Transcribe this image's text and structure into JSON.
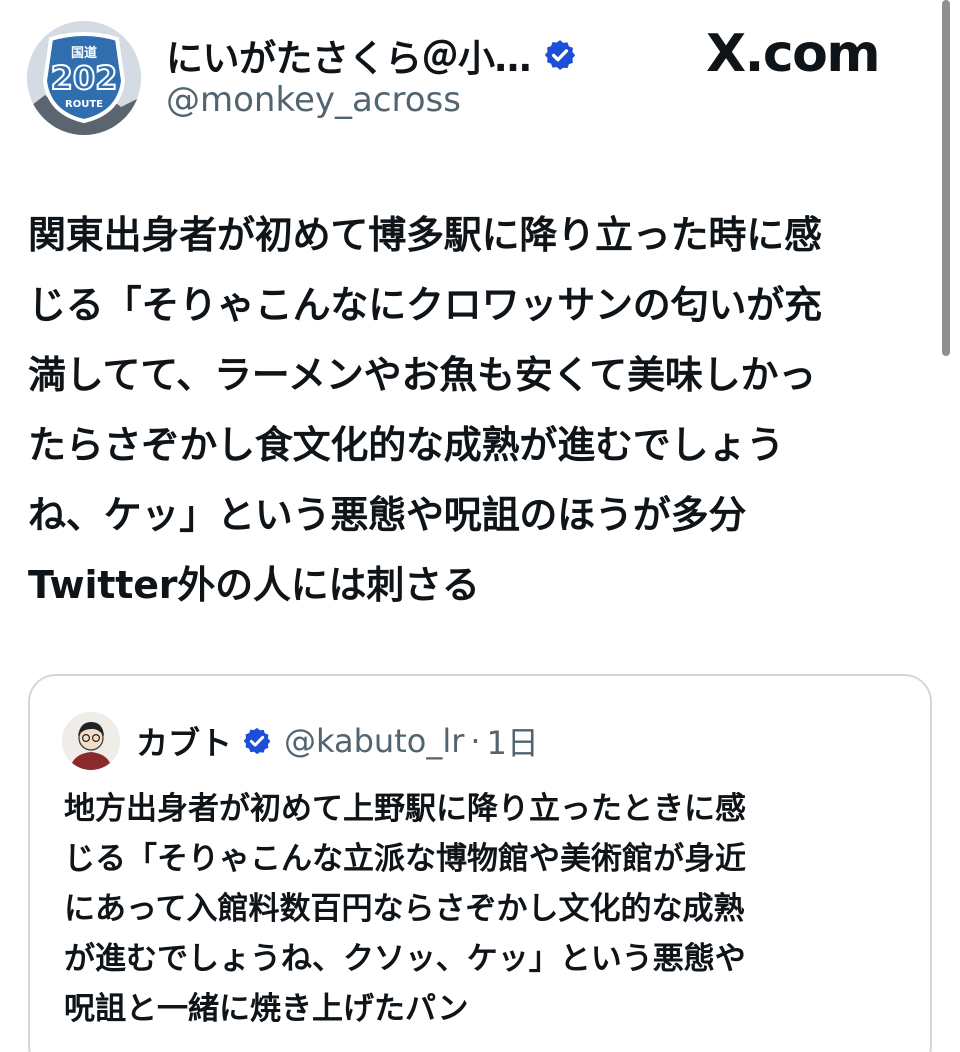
{
  "author": {
    "display_name": "にいがたさくら＠小…",
    "handle": "@monkey_across",
    "avatar_icon": "route-202-sign-icon",
    "avatar_sign": {
      "top": "国道",
      "number": "202",
      "bottom": "ROUTE"
    }
  },
  "brand": {
    "text": "X.com"
  },
  "tweet": {
    "lines": [
      "関東出身者が初めて博多駅に降り立った時に感",
      "じる「そりゃこんなにクロワッサンの匂いが充",
      "満してて、ラーメンやお魚も安くて美味しかっ",
      "たらさぞかし食文化的な成熟が進むでしょう",
      "ね、ケッ」という悪態や呪詛のほうが多分",
      "Twitter外の人には刺さる"
    ]
  },
  "quote": {
    "name": "カブト",
    "handle": "@kabuto_lr",
    "separator": "·",
    "age": "1日",
    "lines": [
      "地方出身者が初めて上野駅に降り立ったときに感",
      "じる「そりゃこんな立派な博物館や美術館が身近",
      "にあって入館料数百円ならさぞかし文化的な成熟",
      "が進むでしょうね、クソッ、ケッ」という悪態や",
      "呪詛と一緒に焼き上げたパン"
    ]
  },
  "colors": {
    "verified": "#1d4ed8",
    "text_primary": "#0f1419",
    "text_secondary": "#536471",
    "card_border": "#cfd9de"
  }
}
